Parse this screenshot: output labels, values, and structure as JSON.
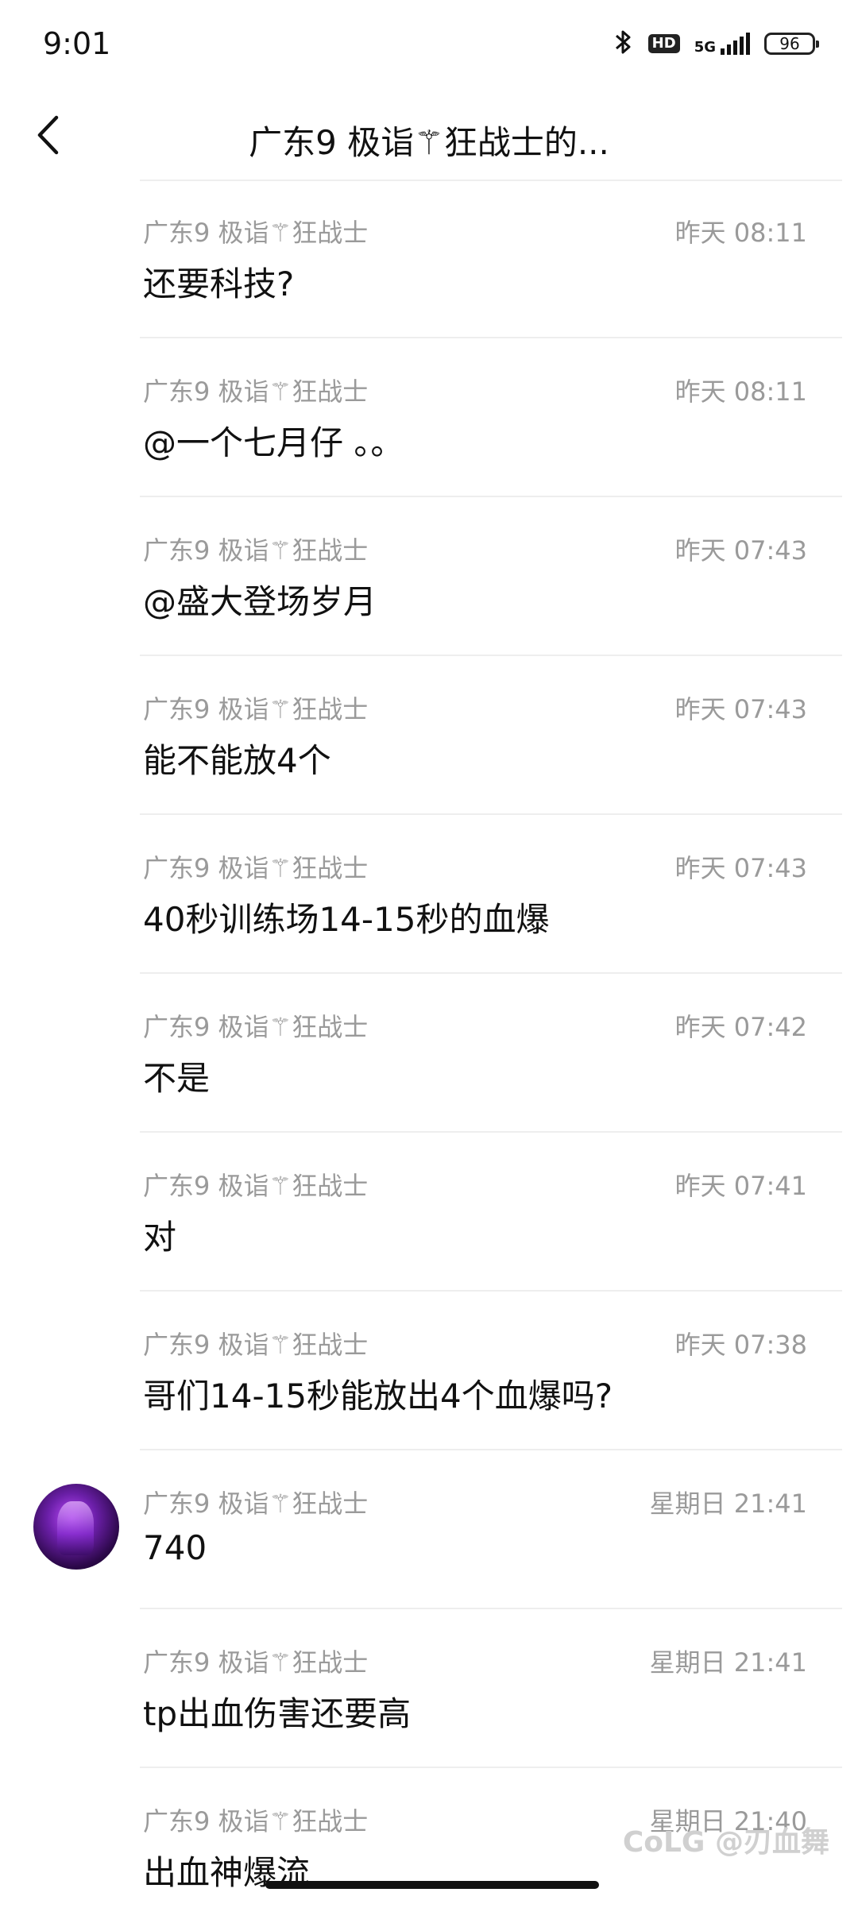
{
  "status_bar": {
    "time": "9:01",
    "network": "5G",
    "hd": "HD",
    "battery": "96",
    "icons": [
      "bluetooth-icon",
      "hd-icon",
      "signal-icon",
      "battery-icon"
    ]
  },
  "header": {
    "title": "广东9 极诣⚚狂战士的...",
    "back_icon": "chevron-left-icon"
  },
  "messages": [
    {
      "sender": "广东9 极诣⚚狂战士",
      "time": "昨天 08:11",
      "text": "还要科技?"
    },
    {
      "sender": "广东9 极诣⚚狂战士",
      "time": "昨天 08:11",
      "text": "@一个七月仔 。。"
    },
    {
      "sender": "广东9 极诣⚚狂战士",
      "time": "昨天 07:43",
      "text": "@盛大登场岁月"
    },
    {
      "sender": "广东9 极诣⚚狂战士",
      "time": "昨天 07:43",
      "text": "能不能放4个"
    },
    {
      "sender": "广东9 极诣⚚狂战士",
      "time": "昨天 07:43",
      "text": "40秒训练场14-15秒的血爆"
    },
    {
      "sender": "广东9 极诣⚚狂战士",
      "time": "昨天 07:42",
      "text": "不是"
    },
    {
      "sender": "广东9 极诣⚚狂战士",
      "time": "昨天 07:41",
      "text": "对"
    },
    {
      "sender": "广东9 极诣⚚狂战士",
      "time": "昨天 07:38",
      "text": "哥们14-15秒能放出4个血爆吗?"
    },
    {
      "sender": "广东9 极诣⚚狂战士",
      "time": "星期日 21:41",
      "text": "740"
    },
    {
      "sender": "广东9 极诣⚚狂战士",
      "time": "星期日 21:41",
      "text": "tp出血伤害还要高"
    },
    {
      "sender": "广东9 极诣⚚狂战士",
      "time": "星期日 21:40",
      "text": "出血神爆流"
    }
  ],
  "watermark": "CoLG @刃血舞"
}
